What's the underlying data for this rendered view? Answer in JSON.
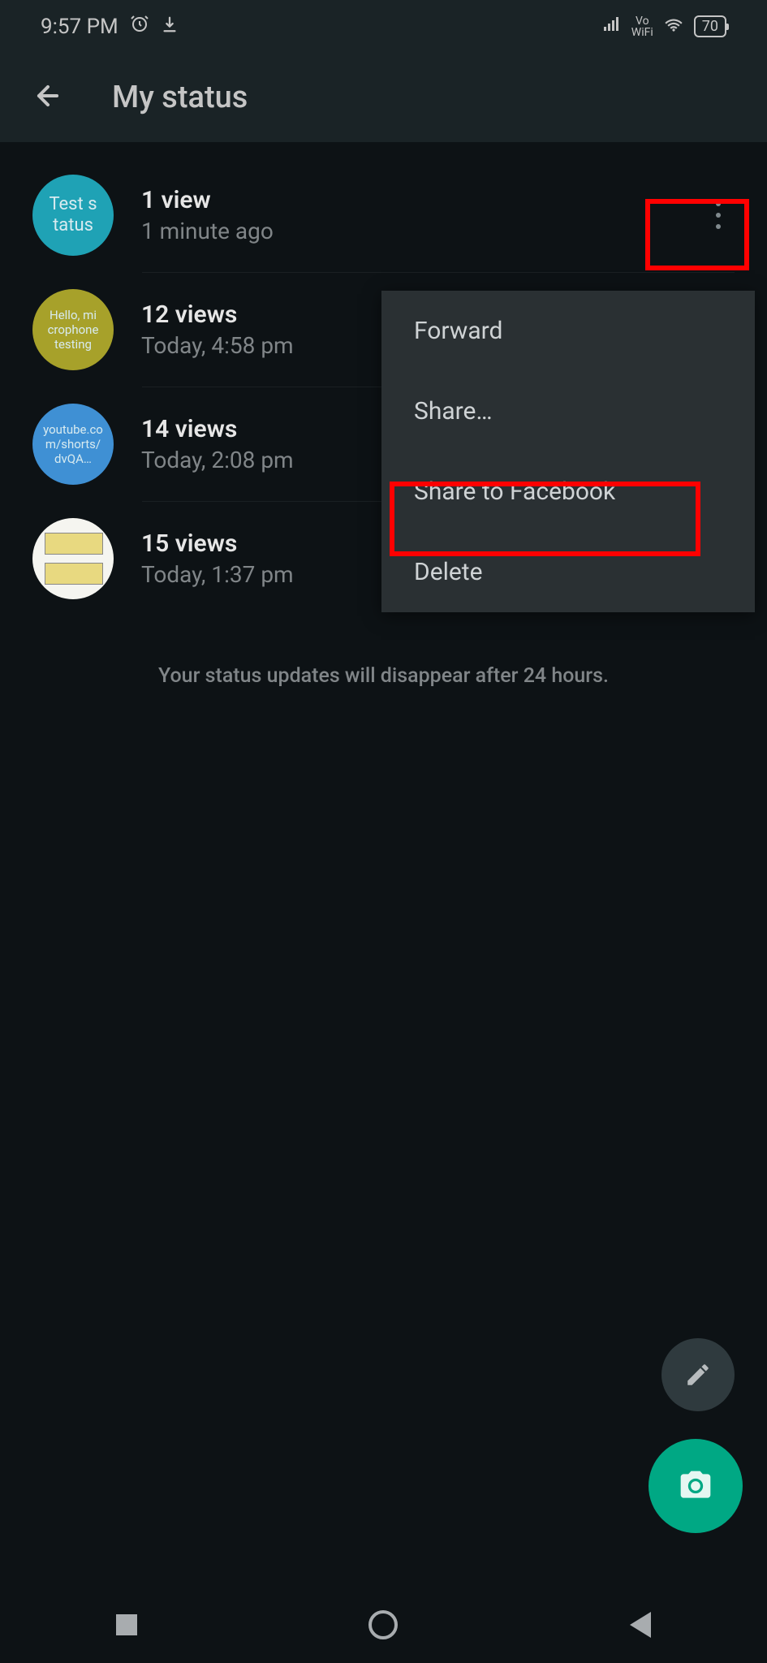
{
  "statusBar": {
    "time": "9:57 PM",
    "battery": "70"
  },
  "appBar": {
    "title": "My status"
  },
  "statuses": [
    {
      "thumbText": "Test s\ntatus",
      "views": "1 view",
      "timestamp": "1 minute ago",
      "thumbClass": "thumb-teal"
    },
    {
      "thumbText": "Hello, mi\ncrophone\ntesting",
      "views": "12 views",
      "timestamp": "Today, 4:58 pm",
      "thumbClass": "thumb-olive"
    },
    {
      "thumbText": "youtube.co\nm/shorts/\ndvQA…",
      "views": "14 views",
      "timestamp": "Today, 2:08 pm",
      "thumbClass": "thumb-blue"
    },
    {
      "thumbText": "",
      "views": "15 views",
      "timestamp": "Today, 1:37 pm",
      "thumbClass": "thumb-image"
    }
  ],
  "contextMenu": {
    "items": [
      "Forward",
      "Share…",
      "Share to Facebook",
      "Delete"
    ]
  },
  "footerNote": "Your status updates will disappear after 24 hours."
}
